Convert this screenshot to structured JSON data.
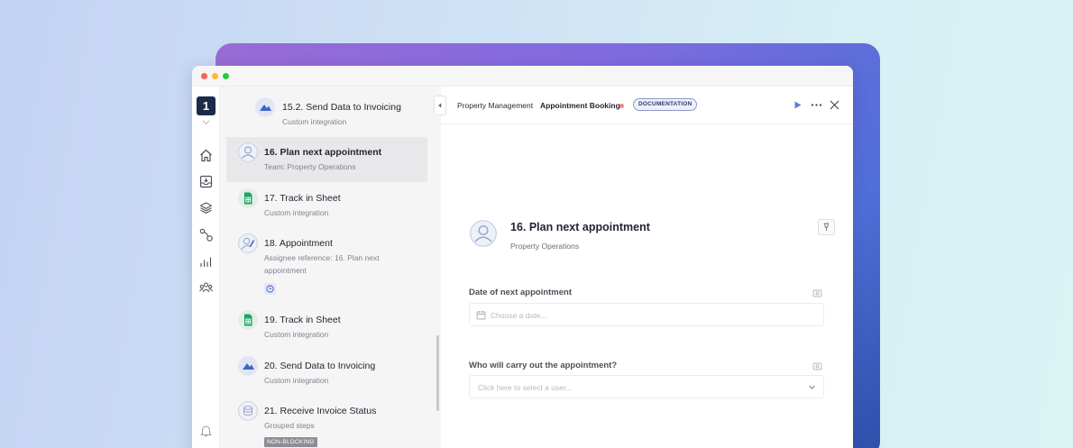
{
  "window": {
    "workspace_badge": "1"
  },
  "sidebar": {
    "items": [
      {
        "title": "15.2. Send Data to Invoicing",
        "sub": "Custom integration",
        "icon": "invoicing-app-icon"
      },
      {
        "title": "16. Plan next appointment",
        "sub": "Team: Property Operations",
        "icon": "person-avatar-icon",
        "selected": true
      },
      {
        "title": "17. Track in Sheet",
        "sub": "Custom integration",
        "icon": "sheets-icon"
      },
      {
        "title": "18. Appointment",
        "sub": "Assignee reference: 16. Plan next appointment",
        "icon": "person-edit-icon"
      },
      {
        "title": "19. Track in Sheet",
        "sub": "Custom integration",
        "icon": "sheets-icon"
      },
      {
        "title": "20. Send Data to Invoicing",
        "sub": "Custom integration",
        "icon": "invoicing-app-icon"
      },
      {
        "title": "21. Receive Invoice Status",
        "sub": "Grouped steps",
        "icon": "stack-icon",
        "tag": "NON-BLOCKING"
      }
    ]
  },
  "header": {
    "breadcrumb_parent": "Property Management",
    "breadcrumb_current": "Appointment Booking",
    "badge": "DOCUMENTATION"
  },
  "detail": {
    "title": "16. Plan next appointment",
    "subtitle": "Property Operations",
    "fields": [
      {
        "label": "Date of next appointment",
        "placeholder": "Choose a date..."
      },
      {
        "label": "Who will carry out the appointment?",
        "placeholder": "Click here to select a user..."
      }
    ]
  },
  "colors": {
    "accent": "#5b7fd8",
    "status_dot": "#f0867a",
    "sheets_green": "#1fa463",
    "workspace_badge_bg": "#1c2b4a"
  }
}
